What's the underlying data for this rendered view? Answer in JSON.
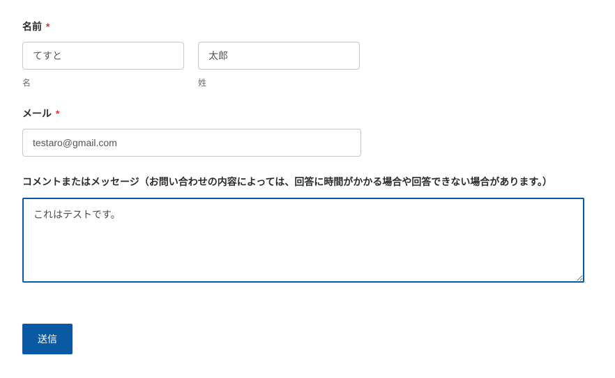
{
  "form": {
    "name": {
      "label": "名前",
      "required_mark": "*",
      "first": {
        "value": "てすと",
        "sublabel": "名"
      },
      "last": {
        "value": "太郎",
        "sublabel": "姓"
      }
    },
    "email": {
      "label": "メール",
      "required_mark": "*",
      "value": "testaro@gmail.com"
    },
    "message": {
      "label": "コメントまたはメッセージ（お問い合わせの内容によっては、回答に時間がかかる場合や回答できない場合があります。）",
      "value": "これはテストです。"
    },
    "submit": {
      "label": "送信"
    }
  },
  "colors": {
    "accent": "#0a5aa3",
    "required": "#d63638"
  }
}
